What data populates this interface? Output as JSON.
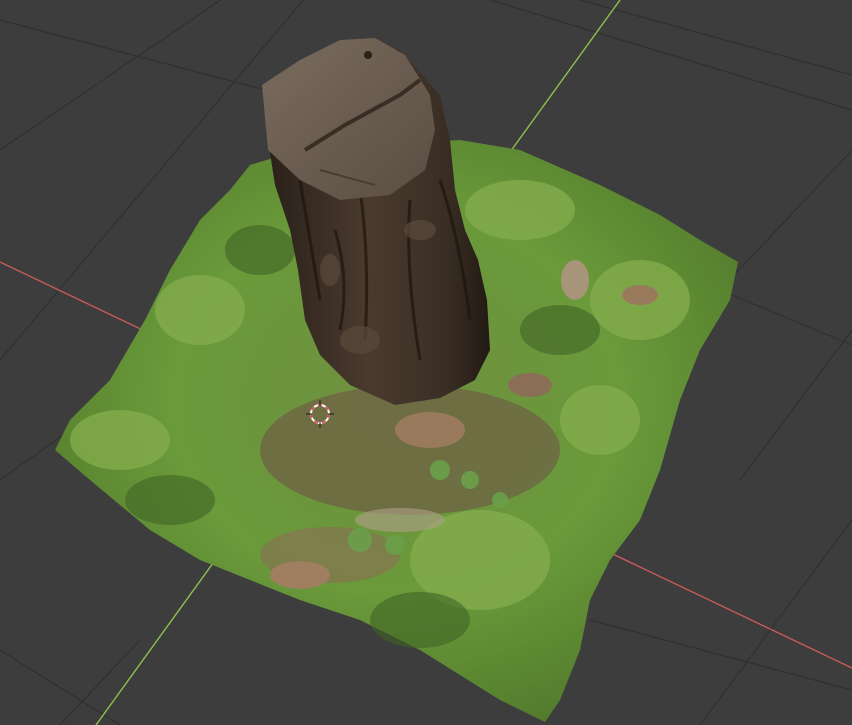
{
  "viewport": {
    "background_color": "#3d3d3d",
    "grid_color": "#2f2f2f",
    "x_axis_color": "#c85a5a",
    "y_axis_color": "#8bc34a"
  },
  "scene": {
    "objects": [
      {
        "name": "tree-stump",
        "colors": {
          "bark_dark": "#2a211a",
          "bark_mid": "#4a3a2e",
          "cut_top": "#6b5e52"
        }
      },
      {
        "name": "grass-terrain-mesh",
        "colors": {
          "grass_light": "#7da04a",
          "grass_mid": "#5f8a34",
          "grass_dark": "#3f6425",
          "soil": "#6e5a45",
          "leaf": "#9a7a5c"
        }
      }
    ]
  },
  "cursor": {
    "icon": "3d-cursor-icon",
    "color": "#d25a5a"
  }
}
